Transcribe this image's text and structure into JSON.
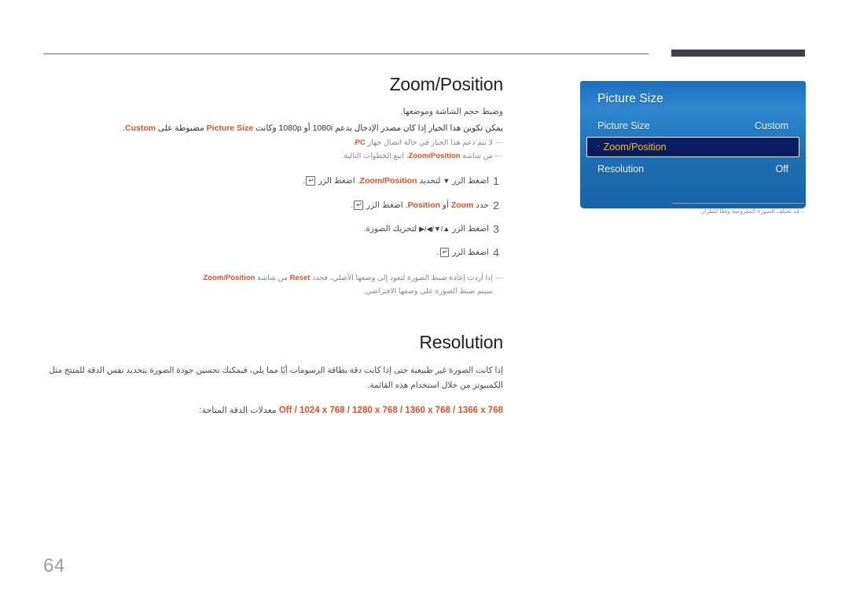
{
  "page": {
    "number": "64",
    "language": "ar"
  },
  "sections": [
    {
      "id": "zoom-position",
      "title": "Zoom/Position",
      "lead": "وضبط حجم الشاشة وموضعها.",
      "description_parts": [
        "يمكن تكوين هذا الخيار إذا كان مصدر الإدخال يدعم 1080i أو 1080p وكانت ",
        "Picture Size",
        " مضبوطة على ",
        "Custom",
        "."
      ],
      "notes": [
        {
          "parts": [
            "لا يتم دعم هذا الخيار في حالة اتصال جهاز ",
            "PC",
            "."
          ]
        },
        {
          "parts": [
            "من شاشة ",
            "Zoom/Position",
            "، اتبع الخطوات التالية."
          ]
        }
      ],
      "steps": [
        {
          "number": "1",
          "parts": [
            "اضغط الزر ",
            "▼",
            " لتحديد ",
            "Zoom/Position",
            ". اضغط الزر ",
            "ENTER",
            "."
          ]
        },
        {
          "number": "2",
          "parts": [
            "حدد ",
            "Zoom",
            " أو ",
            "Position",
            ". اضغط الزر ",
            "ENTER",
            "."
          ]
        },
        {
          "number": "3",
          "parts": [
            "اضغط الزر ",
            "▲/▼/◀/▶",
            " لتحريك الصورة."
          ]
        },
        {
          "number": "4",
          "parts": [
            "اضغط الزر ",
            "ENTER",
            "."
          ]
        }
      ],
      "footer_note": {
        "line1_parts": [
          "إذا أردت إعادة ضبط الصورة لتعود إلى وضعها الأصلي، فحدد ",
          "Reset",
          " من شاشة ",
          "Zoom/Position",
          "."
        ],
        "line2": "سيتم ضبط الصورة على وضعها الافتراضي."
      }
    },
    {
      "id": "resolution",
      "title": "Resolution",
      "paragraph": "إذا كانت الصورة غير طبيعية حتى إذا كانت دقة بطاقة الرسومات أيًا مما يلي، فيمكنك تحسين جودة الصورة بتحديد نفس الدقة للمنتج مثل الكمبيوتر من خلال استخدام هذه القائمة.",
      "list_label": "معدلات الدقة المتاحة:",
      "list_values": "Off / 1024 x 768 / 1280 x 768 / 1360 x 768 / 1366 x 768"
    }
  ],
  "osd": {
    "title": "Picture Size",
    "rows": [
      {
        "label": "Picture Size",
        "value": "Custom",
        "selected": false,
        "bullet": ""
      },
      {
        "label": "Zoom/Position",
        "value": "",
        "selected": true,
        "bullet": "·"
      },
      {
        "label": "Resolution",
        "value": "Off",
        "selected": false,
        "bullet": ""
      }
    ],
    "note": "قد تختلف الصورة المعروضة وفقًا للطراز.",
    "note_dash": "‒",
    "colors": {
      "panel_blue": "#1d6fbd",
      "selected_bg": "#0b1c63",
      "selected_text": "#f0c419"
    }
  },
  "theme": {
    "accent": "#e0502a",
    "rule": "#6b6870",
    "bar": "#413e4b",
    "page_number_color": "#9aa0a6"
  }
}
